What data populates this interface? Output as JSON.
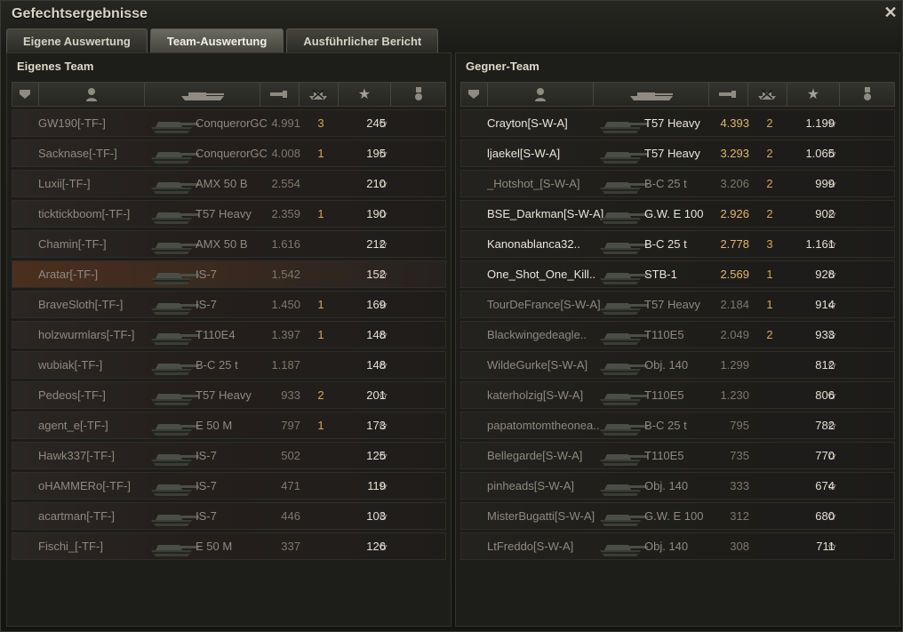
{
  "window": {
    "title": "Gefechtsergebnisse",
    "close_icon": "close-icon"
  },
  "tabs": [
    {
      "label": "Eigene Auswertung",
      "active": false
    },
    {
      "label": "Team-Auswertung",
      "active": true
    },
    {
      "label": "Ausführlicher Bericht",
      "active": false
    }
  ],
  "columns": [
    "squad-icon",
    "player-icon",
    "vehicle-icon",
    "damage-icon",
    "kills-icon",
    "xp-star-icon",
    "medal-icon"
  ],
  "left": {
    "title": "Eigenes Team",
    "rows": [
      {
        "name": "GW190[-TF-]",
        "vehicle": "ConquerorGC",
        "damage": "4.991",
        "kills": "3",
        "xp": "245",
        "alive": false,
        "self": false
      },
      {
        "name": "Sacknase[-TF-]",
        "vehicle": "ConquerorGC",
        "damage": "4.008",
        "kills": "1",
        "xp": "195",
        "alive": false,
        "self": false
      },
      {
        "name": "Luxii[-TF-]",
        "vehicle": "AMX 50 B",
        "damage": "2.554",
        "kills": "",
        "xp": "210",
        "alive": false,
        "self": false
      },
      {
        "name": "ticktickboom[-TF-]",
        "vehicle": "T57 Heavy",
        "damage": "2.359",
        "kills": "1",
        "xp": "190",
        "alive": false,
        "self": false
      },
      {
        "name": "Chamin[-TF-]",
        "vehicle": "AMX 50 B",
        "damage": "1.616",
        "kills": "",
        "xp": "212",
        "alive": false,
        "self": false
      },
      {
        "name": "Aratar[-TF-]",
        "vehicle": "IS-7",
        "damage": "1.542",
        "kills": "",
        "xp": "152",
        "alive": false,
        "self": true
      },
      {
        "name": "BraveSloth[-TF-]",
        "vehicle": "IS-7",
        "damage": "1.450",
        "kills": "1",
        "xp": "169",
        "alive": false,
        "self": false
      },
      {
        "name": "holzwurmlars[-TF-]",
        "vehicle": "T110E4",
        "damage": "1.397",
        "kills": "1",
        "xp": "148",
        "alive": false,
        "self": false
      },
      {
        "name": "wubiak[-TF-]",
        "vehicle": "B-C 25 t",
        "damage": "1.187",
        "kills": "",
        "xp": "148",
        "alive": false,
        "self": false
      },
      {
        "name": "Pedeos[-TF-]",
        "vehicle": "T57 Heavy",
        "damage": "933",
        "kills": "2",
        "xp": "201",
        "alive": false,
        "self": false
      },
      {
        "name": "agent_e[-TF-]",
        "vehicle": "E 50 M",
        "damage": "797",
        "kills": "1",
        "xp": "173",
        "alive": false,
        "self": false
      },
      {
        "name": "Hawk337[-TF-]",
        "vehicle": "IS-7",
        "damage": "502",
        "kills": "",
        "xp": "125",
        "alive": false,
        "self": false
      },
      {
        "name": "oHAMMERo[-TF-]",
        "vehicle": "IS-7",
        "damage": "471",
        "kills": "",
        "xp": "119",
        "alive": false,
        "self": false
      },
      {
        "name": "acartman[-TF-]",
        "vehicle": "IS-7",
        "damage": "446",
        "kills": "",
        "xp": "103",
        "alive": false,
        "self": false
      },
      {
        "name": "Fischi_[-TF-]",
        "vehicle": "E 50 M",
        "damage": "337",
        "kills": "",
        "xp": "126",
        "alive": false,
        "self": false
      }
    ]
  },
  "right": {
    "title": "Gegner-Team",
    "rows": [
      {
        "name": "Crayton[S-W-A]",
        "vehicle": "T57 Heavy",
        "damage": "4.393",
        "kills": "2",
        "xp": "1.199",
        "alive": true
      },
      {
        "name": "ljaekel[S-W-A]",
        "vehicle": "T57 Heavy",
        "damage": "3.293",
        "kills": "2",
        "xp": "1.065",
        "alive": true
      },
      {
        "name": "_Hotshot_[S-W-A]",
        "vehicle": "B-C 25 t",
        "damage": "3.206",
        "kills": "2",
        "xp": "999",
        "alive": false
      },
      {
        "name": "BSE_Darkman[S-W-A]",
        "vehicle": "G.W. E 100",
        "damage": "2.926",
        "kills": "2",
        "xp": "902",
        "alive": true
      },
      {
        "name": "Kanonablanca32..",
        "vehicle": "B-C 25 t",
        "damage": "2.778",
        "kills": "3",
        "xp": "1.161",
        "alive": true
      },
      {
        "name": "One_Shot_One_Kill..",
        "vehicle": "STB-1",
        "damage": "2.569",
        "kills": "1",
        "xp": "928",
        "alive": true
      },
      {
        "name": "TourDeFrance[S-W-A]",
        "vehicle": "T57 Heavy",
        "damage": "2.184",
        "kills": "1",
        "xp": "914",
        "alive": false
      },
      {
        "name": "Blackwingedeagle..",
        "vehicle": "T110E5",
        "damage": "2.049",
        "kills": "2",
        "xp": "933",
        "alive": false
      },
      {
        "name": "WildeGurke[S-W-A]",
        "vehicle": "Obj. 140",
        "damage": "1.299",
        "kills": "",
        "xp": "812",
        "alive": false
      },
      {
        "name": "katerholzig[S-W-A]",
        "vehicle": "T110E5",
        "damage": "1.230",
        "kills": "",
        "xp": "806",
        "alive": false
      },
      {
        "name": "papatomtomtheonea..",
        "vehicle": "B-C 25 t",
        "damage": "795",
        "kills": "",
        "xp": "782",
        "alive": false
      },
      {
        "name": "Bellegarde[S-W-A]",
        "vehicle": "T110E5",
        "damage": "735",
        "kills": "",
        "xp": "770",
        "alive": false
      },
      {
        "name": "pinheads[S-W-A]",
        "vehicle": "Obj. 140",
        "damage": "333",
        "kills": "",
        "xp": "674",
        "alive": false
      },
      {
        "name": "MisterBugatti[S-W-A]",
        "vehicle": "G.W. E 100",
        "damage": "312",
        "kills": "",
        "xp": "680",
        "alive": false
      },
      {
        "name": "LtFreddo[S-W-A]",
        "vehicle": "Obj. 140",
        "damage": "308",
        "kills": "",
        "xp": "711",
        "alive": false
      }
    ]
  }
}
